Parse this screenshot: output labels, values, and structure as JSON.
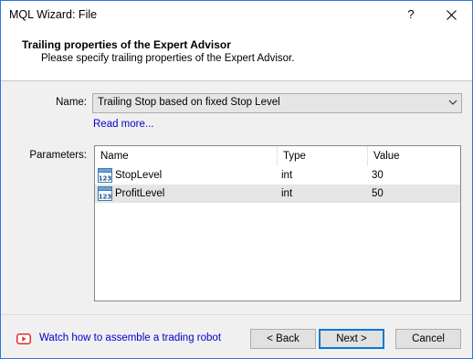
{
  "window": {
    "title": "MQL Wizard: File",
    "help_glyph": "?",
    "close_icon": "close-icon"
  },
  "header": {
    "title": "Trailing properties of the Expert Advisor",
    "subtitle": "Please specify trailing properties of the Expert Advisor."
  },
  "form": {
    "name_label": "Name:",
    "name_value": "Trailing Stop based on fixed Stop Level",
    "read_more": "Read more...",
    "parameters_label": "Parameters:"
  },
  "parameters": {
    "columns": [
      "Name",
      "Type",
      "Value"
    ],
    "rows": [
      {
        "name": "StopLevel",
        "type": "int",
        "value": "30",
        "selected": false
      },
      {
        "name": "ProfitLevel",
        "type": "int",
        "value": "50",
        "selected": true
      }
    ],
    "row_icon": "integer-123-icon"
  },
  "footer": {
    "watch_link": "Watch how to assemble a trading robot",
    "video_icon": "youtube-play-icon",
    "back_button": "< Back",
    "next_button": "Next >",
    "cancel_button": "Cancel"
  },
  "colors": {
    "link": "#0000cc",
    "accent": "#0078d7",
    "video_icon": "#e52d27"
  }
}
